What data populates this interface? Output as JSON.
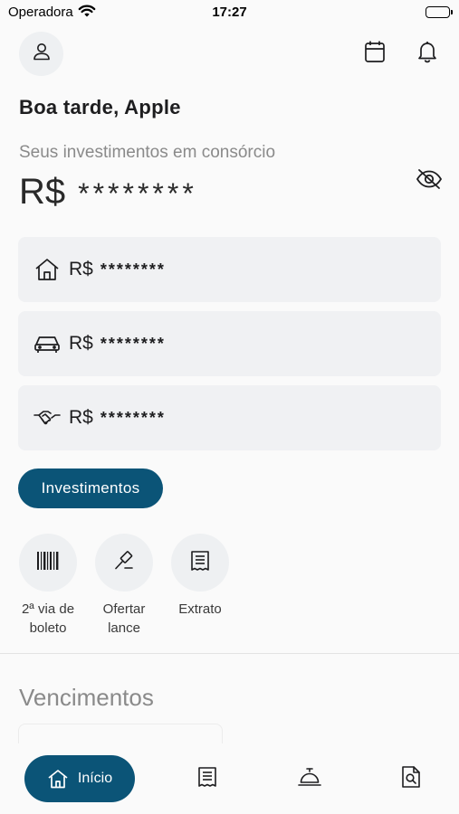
{
  "status_bar": {
    "carrier": "Operadora",
    "time": "17:27"
  },
  "header": {
    "greeting": "Boa tarde, Apple",
    "profile_icon": "person-icon",
    "calendar_icon": "calendar-icon",
    "bell_icon": "bell-icon"
  },
  "investments": {
    "label": "Seus investimentos em consórcio",
    "currency": "R$",
    "masked_total": "********",
    "visibility_icon": "eye-slash-icon"
  },
  "cards": [
    {
      "icon": "house-icon",
      "currency": "R$",
      "masked_value": "********"
    },
    {
      "icon": "car-icon",
      "currency": "R$",
      "masked_value": "********"
    },
    {
      "icon": "handshake-icon",
      "currency": "R$",
      "masked_value": "********"
    }
  ],
  "invest_button": {
    "label": "Investimentos"
  },
  "quick_actions": [
    {
      "icon": "barcode-icon",
      "line1": "2ª via de",
      "line2": "boleto"
    },
    {
      "icon": "gavel-icon",
      "line1": "Ofertar",
      "line2": "lance"
    },
    {
      "icon": "receipt-icon",
      "line1": "Extrato",
      "line2": ""
    }
  ],
  "vencimentos": {
    "title": "Vencimentos"
  },
  "tabbar": {
    "home_label": "Início",
    "tabs": [
      "home-icon",
      "receipt-icon",
      "service-bell-icon",
      "document-search-icon"
    ]
  },
  "colors": {
    "accent": "#0b5477",
    "card_bg": "#f0f1f3",
    "circle_bg": "#eef0f2",
    "muted_text": "#8a8a8a"
  }
}
